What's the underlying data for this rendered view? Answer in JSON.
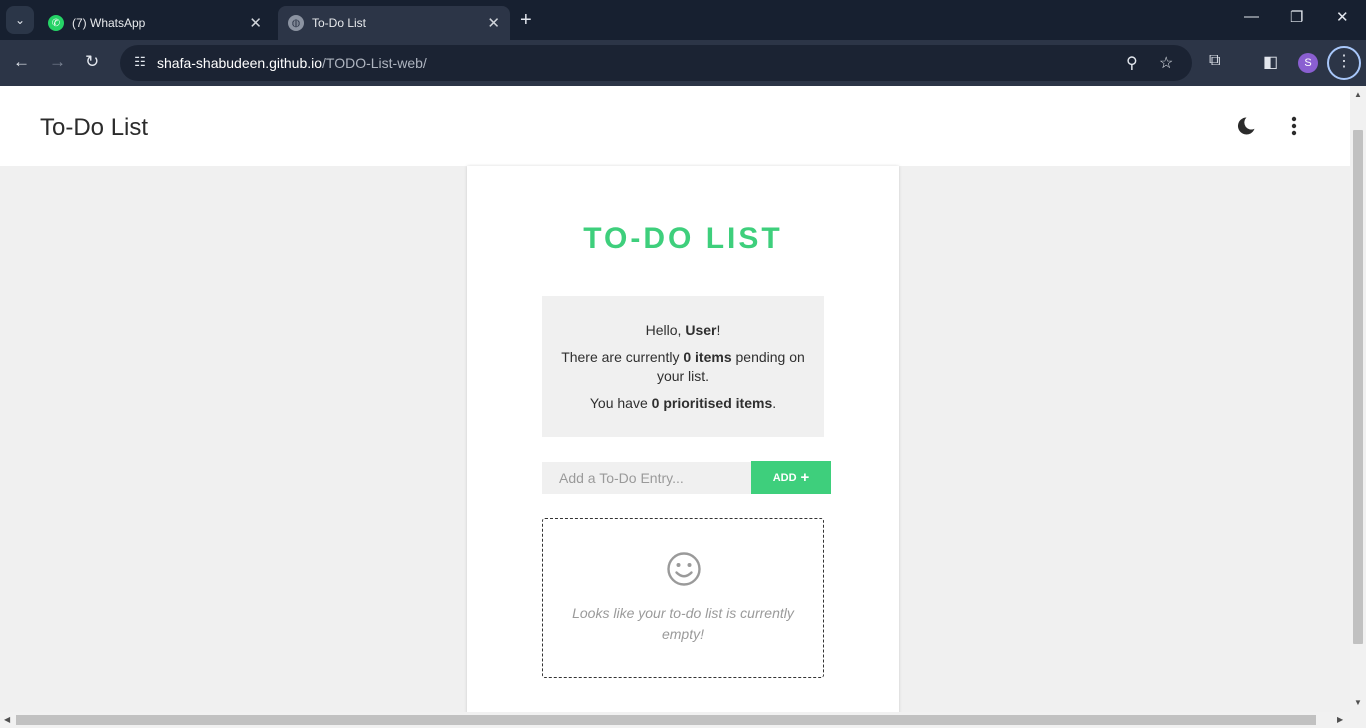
{
  "browser": {
    "tabs": [
      {
        "title": "(7) WhatsApp",
        "icon": "whatsapp-icon",
        "active": false
      },
      {
        "title": "To-Do List",
        "icon": "globe-icon",
        "active": true
      }
    ],
    "url_host": "shafa-shabudeen.github.io",
    "url_path": "/TODO-List-web/",
    "profile_initial": "S"
  },
  "app": {
    "title": "To-Do List",
    "heading": "TO-DO LIST",
    "greeting_prefix": "Hello, ",
    "user_name": "User",
    "greeting_suffix": "!",
    "pending_prefix": "There are currently ",
    "pending_count": "0 items",
    "pending_suffix": " pending on your list.",
    "priority_prefix": "You have ",
    "priority_count": "0 prioritised items",
    "priority_suffix": ".",
    "entry_placeholder": "Add a To-Do Entry...",
    "add_label": "ADD",
    "empty_message": "Looks like your to-do list is currently empty!"
  },
  "colors": {
    "accent": "#3ecf7c",
    "panel": "#f0f0f0",
    "chrome_dark": "#172030"
  }
}
